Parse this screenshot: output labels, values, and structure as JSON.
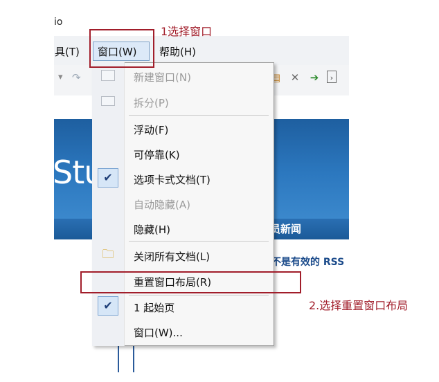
{
  "window": {
    "title_fragment": "io"
  },
  "menubar": {
    "items": [
      {
        "label": "具(T)"
      },
      {
        "label": "窗口(W)"
      },
      {
        "label": "帮助(H)"
      }
    ]
  },
  "toolbar": {
    "left_arrow": "▾",
    "undo_glyph": "↷"
  },
  "background": {
    "banner_text": "Stu",
    "news_tab": "员新闻",
    "rss_text": "不是有效的 RSS"
  },
  "dropdown": {
    "items": [
      {
        "label": "新建窗口(N)",
        "disabled": true,
        "icon": "new-window-icon"
      },
      {
        "label": "拆分(P)",
        "disabled": true,
        "icon": "split-icon"
      },
      {
        "label": "浮动(F)",
        "disabled": false
      },
      {
        "label": "可停靠(K)",
        "disabled": false
      },
      {
        "label": "选项卡式文档(T)",
        "disabled": false,
        "checked": true
      },
      {
        "label": "自动隐藏(A)",
        "disabled": true
      },
      {
        "label": "隐藏(H)",
        "disabled": false
      },
      {
        "label": "关闭所有文档(L)",
        "disabled": false,
        "icon": "folder-icon"
      },
      {
        "label": "重置窗口布局(R)",
        "disabled": false
      },
      {
        "label": "1 起始页",
        "disabled": false,
        "checked": true
      },
      {
        "label": "窗口(W)...",
        "disabled": false
      }
    ],
    "check_glyph": "✔"
  },
  "annotations": {
    "step1": "1选择窗口",
    "step2": "2.选择重置窗口布局",
    "color": "#a11d2a"
  }
}
